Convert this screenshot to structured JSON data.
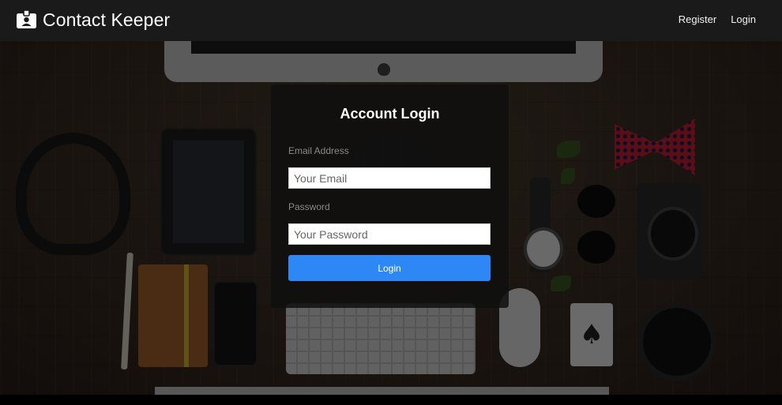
{
  "navbar": {
    "brand_icon": "id-badge-icon",
    "brand_title": "Contact Keeper",
    "links": [
      {
        "label": "Register"
      },
      {
        "label": "Login"
      }
    ]
  },
  "login_form": {
    "title": "Account Login",
    "email_label": "Email Address",
    "email_placeholder": "Your Email",
    "email_value": "",
    "password_label": "Password",
    "password_placeholder": "Your Password",
    "password_value": "",
    "submit_label": "Login"
  },
  "colors": {
    "navbar_bg": "#1a1a1a",
    "primary_button": "#2d88f5",
    "card_bg": "rgba(15,15,15,0.86)"
  }
}
